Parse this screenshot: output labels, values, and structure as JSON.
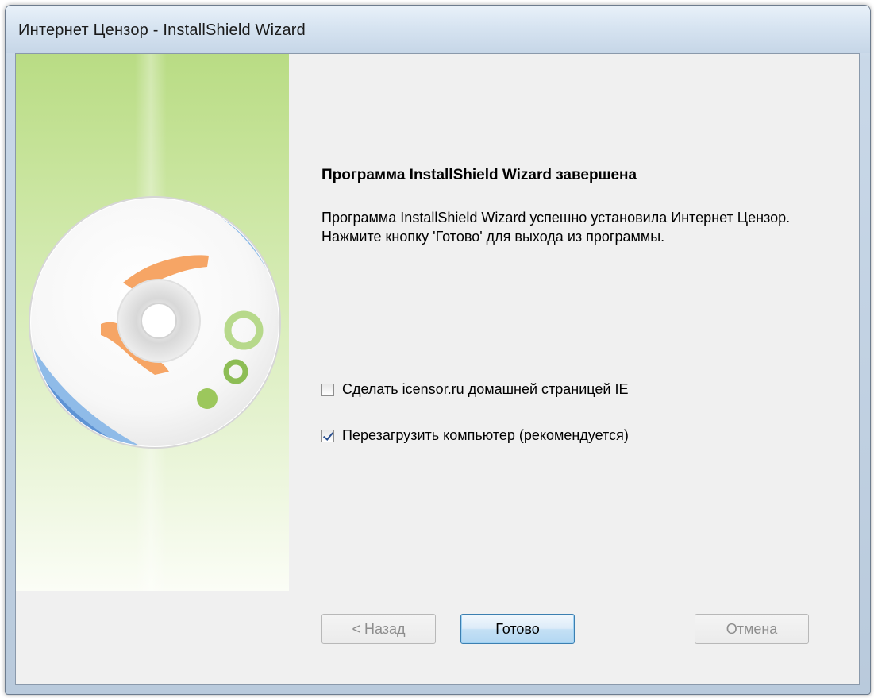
{
  "window": {
    "title": "Интернет Цензор - InstallShield Wizard"
  },
  "content": {
    "heading": "Программа InstallShield Wizard завершена",
    "description": "Программа InstallShield Wizard успешно установила Интернет Цензор. Нажмите кнопку 'Готово' для выхода из программы."
  },
  "options": [
    {
      "label": "Сделать icensor.ru домашней страницей IE",
      "checked": false
    },
    {
      "label": "Перезагрузить компьютер (рекомендуется)",
      "checked": true
    }
  ],
  "buttons": {
    "back": {
      "label": "< Назад",
      "enabled": false
    },
    "finish": {
      "label": "Готово",
      "enabled": true
    },
    "cancel": {
      "label": "Отмена",
      "enabled": false
    }
  },
  "banner": {
    "icon": "cd-disc-icon",
    "colors": {
      "green_top": "#b9dc84",
      "blue_arc": "#6aa0dc",
      "orange_hand": "#f6a565",
      "green_ring": "#9cc75c"
    }
  }
}
